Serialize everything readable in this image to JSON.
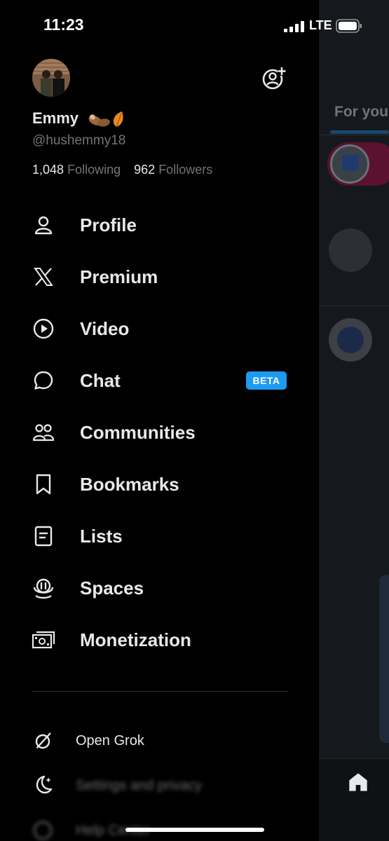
{
  "status": {
    "time": "11:23",
    "network": "LTE"
  },
  "profile": {
    "name": "Emmy",
    "handle": "@hushemmy18",
    "following_count": "1,048",
    "following_label": "Following",
    "followers_count": "962",
    "followers_label": "Followers"
  },
  "menu": {
    "items": [
      {
        "label": "Profile",
        "icon": "person-icon"
      },
      {
        "label": "Premium",
        "icon": "x-logo-icon"
      },
      {
        "label": "Video",
        "icon": "play-circle-icon"
      },
      {
        "label": "Chat",
        "icon": "chat-bubble-icon",
        "badge": "BETA"
      },
      {
        "label": "Communities",
        "icon": "people-icon"
      },
      {
        "label": "Bookmarks",
        "icon": "bookmark-icon"
      },
      {
        "label": "Lists",
        "icon": "list-icon"
      },
      {
        "label": "Spaces",
        "icon": "microphone-icon"
      },
      {
        "label": "Monetization",
        "icon": "money-icon"
      }
    ]
  },
  "footer": {
    "open_grok": "Open Grok",
    "settings": "Settings and privacy",
    "help": "Help Center"
  },
  "background": {
    "tab_label": "For you"
  },
  "colors": {
    "accent": "#1d9bf0",
    "muted": "#71767b",
    "text": "#e7e9ea",
    "background": "#000000"
  }
}
